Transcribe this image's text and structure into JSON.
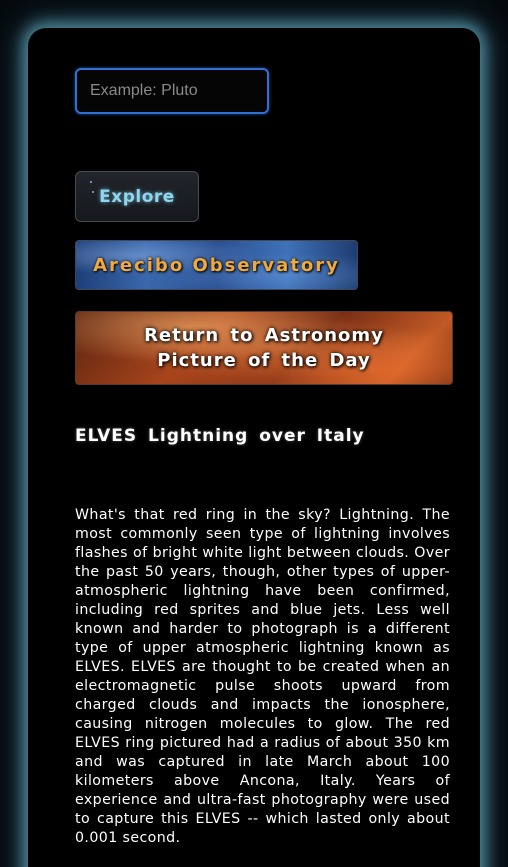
{
  "search": {
    "placeholder": "Example: Pluto",
    "value": ""
  },
  "buttons": {
    "explore_label": "Explore",
    "arecibo_label": "Arecibo Observatory",
    "apod_label": "Return to Astronomy Picture of the Day"
  },
  "article": {
    "title": "ELVES Lightning over Italy",
    "explanation": "What's that red ring in the sky? Lightning. The most commonly seen type of lightning involves flashes of bright white light between clouds. Over the past 50 years, though, other types of upper-atmospheric lightning have been confirmed, including red sprites and blue jets. Less well known and harder to photograph is a different type of upper atmospheric lightning known as ELVES. ELVES are thought to be created when an electromagnetic pulse shoots upward from charged clouds and impacts the ionosphere, causing nitrogen molecules to glow. The red ELVES ring pictured had a radius of about 350 km and was captured in late March about 100 kilometers above Ancona, Italy. Years of experience and ultra-fast photography were used to capture this ELVES -- which lasted only about 0.001 second."
  },
  "colors": {
    "panel_glow": "#78cde6",
    "search_border": "#2f6fd6",
    "explore_text": "#8fd6ee",
    "arecibo_text": "#f0a93a",
    "page_text": "#ffffff"
  }
}
